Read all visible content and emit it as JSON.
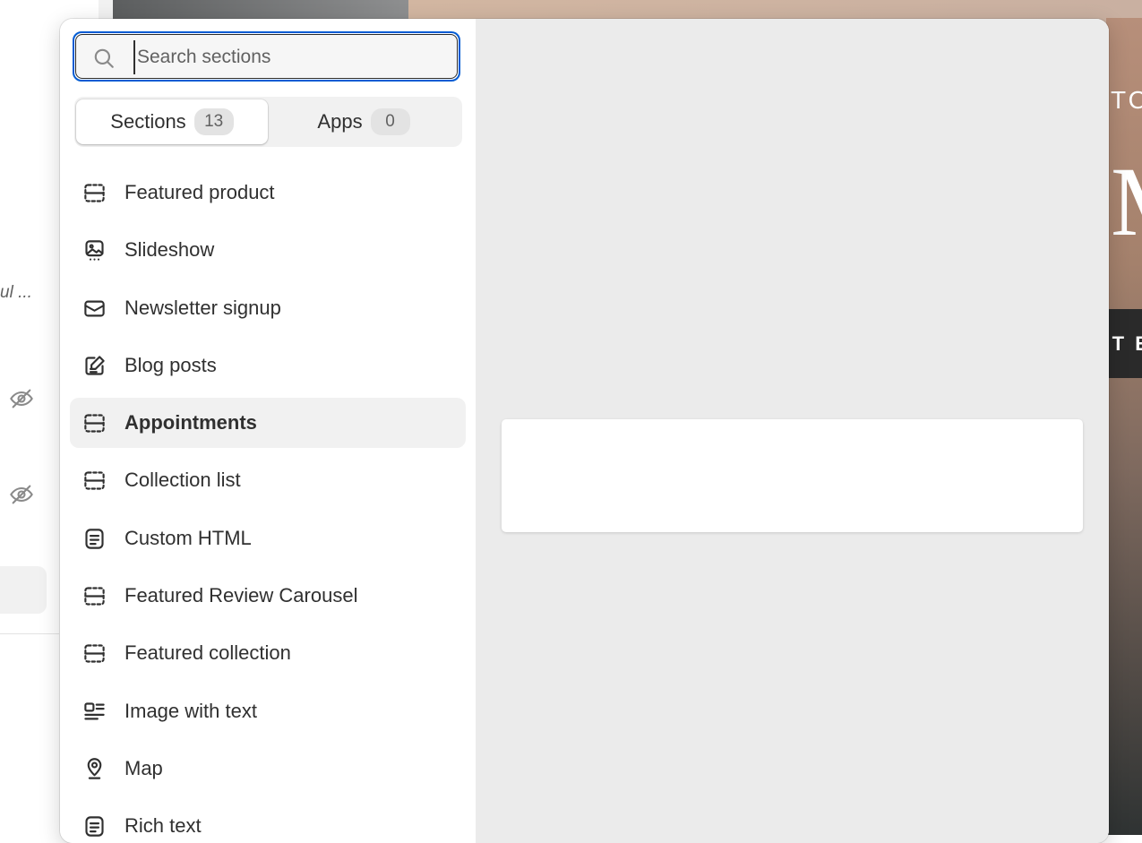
{
  "background": {
    "sidebar_truncated_text": "ul ...",
    "preview_heading_fragment": "TO",
    "preview_big_letter": "M",
    "preview_button_fragment": "ST E"
  },
  "search": {
    "placeholder": "Search sections",
    "value": ""
  },
  "tabs": [
    {
      "label": "Sections",
      "count": "13",
      "active": true
    },
    {
      "label": "Apps",
      "count": "0",
      "active": false
    }
  ],
  "sections": [
    {
      "label": "Featured product",
      "icon": "dashed-section-icon"
    },
    {
      "label": "Slideshow",
      "icon": "slideshow-icon"
    },
    {
      "label": "Newsletter signup",
      "icon": "envelope-icon"
    },
    {
      "label": "Blog posts",
      "icon": "edit-note-icon"
    },
    {
      "label": "Appointments",
      "icon": "dashed-section-icon",
      "hovered": true
    },
    {
      "label": "Collection list",
      "icon": "dashed-section-icon"
    },
    {
      "label": "Custom HTML",
      "icon": "text-block-icon"
    },
    {
      "label": "Featured Review Carousel",
      "icon": "dashed-section-icon"
    },
    {
      "label": "Featured collection",
      "icon": "dashed-section-icon"
    },
    {
      "label": "Image with text",
      "icon": "image-with-text-icon"
    },
    {
      "label": "Map",
      "icon": "map-pin-icon"
    },
    {
      "label": "Rich text",
      "icon": "text-block-icon"
    }
  ],
  "colors": {
    "focus_ring": "#005bd3",
    "hover_row": "#f1f1f1",
    "preview_pane": "#ebebeb",
    "text": "#303030"
  }
}
